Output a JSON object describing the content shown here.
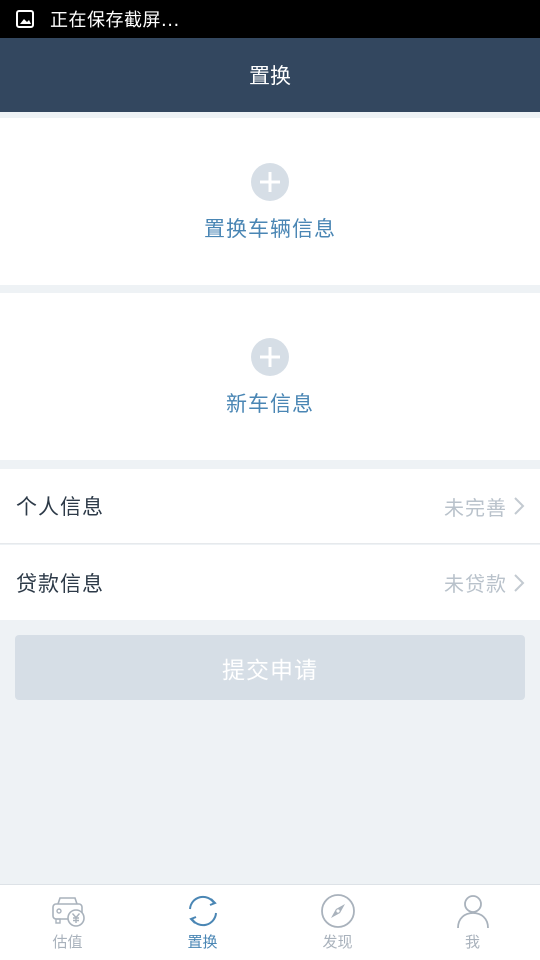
{
  "status_bar": {
    "text": "正在保存截屏..."
  },
  "header": {
    "title": "置换"
  },
  "cards": [
    {
      "label": "置换车辆信息"
    },
    {
      "label": "新车信息"
    }
  ],
  "info_rows": [
    {
      "label": "个人信息",
      "status": "未完善"
    },
    {
      "label": "贷款信息",
      "status": "未贷款"
    }
  ],
  "submit": {
    "label": "提交申请"
  },
  "tabs": [
    {
      "label": "估值",
      "icon": "car-valuation-icon",
      "active": false
    },
    {
      "label": "置换",
      "icon": "exchange-icon",
      "active": true
    },
    {
      "label": "发现",
      "icon": "compass-icon",
      "active": false
    },
    {
      "label": "我",
      "icon": "user-icon",
      "active": false
    }
  ],
  "colors": {
    "header_bg": "#33475f",
    "accent": "#4a86b4",
    "disabled": "#d6dee6",
    "tab_inactive": "#a9b2bc"
  }
}
